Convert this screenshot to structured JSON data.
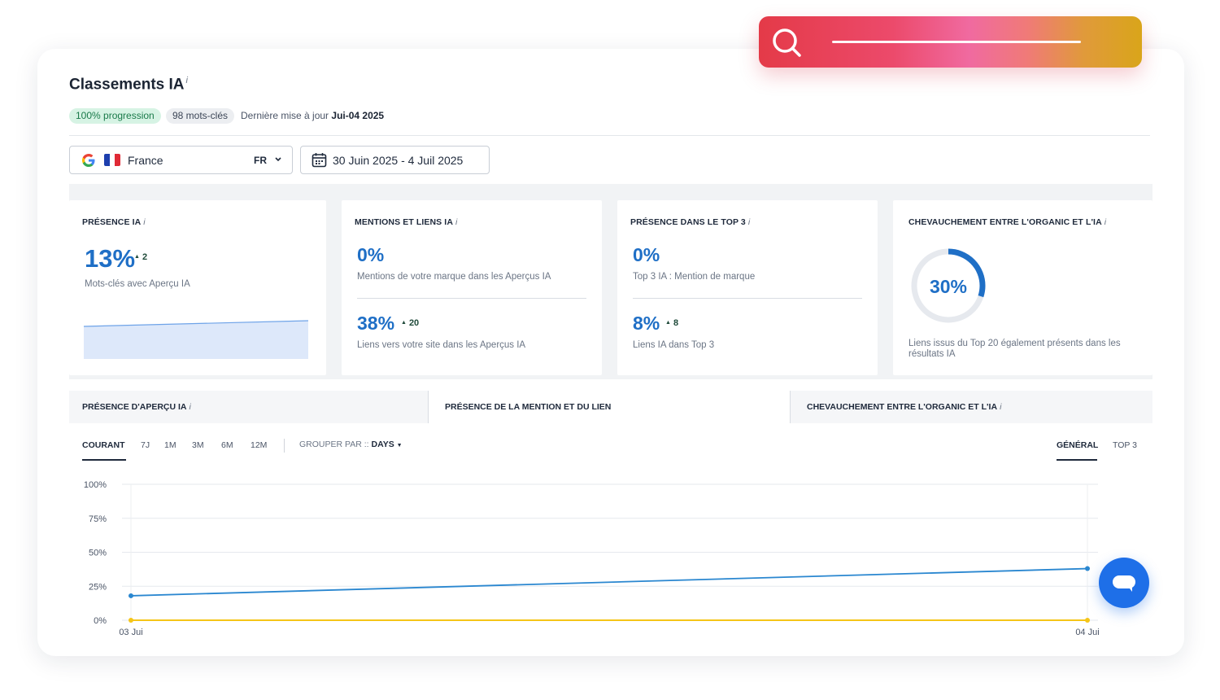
{
  "header": {
    "title": "Classements IA",
    "info": "i",
    "badge_progress": "100% progression",
    "badge_keywords": "98 mots-clés",
    "updated_prefix": "Dernière mise à jour",
    "updated_date": "Jui-04 2025"
  },
  "filters": {
    "country": "France",
    "language": "FR",
    "date_range": "30 Juin 2025 - 4 Juil 2025"
  },
  "metrics": {
    "presence": {
      "title": "PRÉSENCE IA",
      "value": "13%",
      "delta": "2",
      "desc": "Mots-clés avec Aperçu IA"
    },
    "mentions": {
      "title": "MENTIONS ET LIENS IA",
      "value": "0%",
      "desc": "Mentions de votre marque dans les Aperçus IA",
      "value2": "38%",
      "delta2": "20",
      "desc2": "Liens vers votre site dans les Aperçus IA"
    },
    "top3": {
      "title": "PRÉSENCE DANS LE TOP 3",
      "value": "0%",
      "desc": "Top 3 IA : Mention de marque",
      "value2": "8%",
      "delta2": "8",
      "desc2": "Liens IA dans Top 3"
    },
    "overlap": {
      "title": "CHEVAUCHEMENT ENTRE L'ORGANIC ET L'IA",
      "value": "30%",
      "ratio": 0.3,
      "desc": "Liens issus du Top 20 également présents dans les résultats IA"
    }
  },
  "tabs": [
    {
      "label": "PRÉSENCE D'APERÇU IA"
    },
    {
      "label": "PRÉSENCE DE LA MENTION ET DU LIEN"
    },
    {
      "label": "CHEVAUCHEMENT ENTRE L'ORGANIC ET L'IA"
    }
  ],
  "ranges": [
    "COURANT",
    "7J",
    "1M",
    "3M",
    "6M",
    "12M"
  ],
  "group_by": {
    "label": "GROUPER PAR ::",
    "value": "DAYS"
  },
  "view_toggle": [
    "GÉNÉRAL",
    "TOP 3"
  ],
  "colors": {
    "accent": "#1f6fc6",
    "series_blue": "#2a87d0",
    "series_yellow": "#f5c518",
    "chat": "#1e6fe8"
  },
  "chart_data": {
    "type": "line",
    "x": [
      "03 Jui",
      "04 Jui"
    ],
    "yticks": [
      "100%",
      "75%",
      "50%",
      "25%",
      "0%"
    ],
    "ylim": [
      0,
      100
    ],
    "series": [
      {
        "values": [
          18,
          38
        ]
      },
      {
        "values": [
          0,
          0
        ]
      }
    ],
    "grid": true
  }
}
